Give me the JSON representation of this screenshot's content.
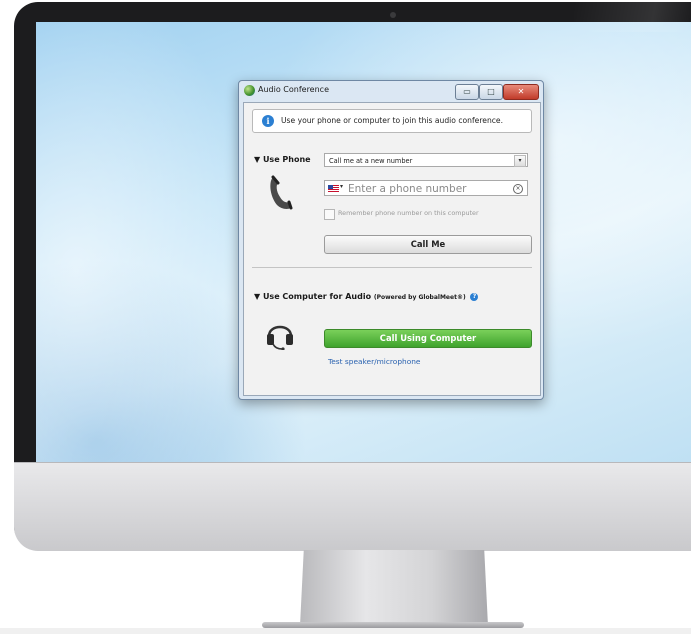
{
  "dialog": {
    "title": "Audio Conference",
    "window_buttons": {
      "minimize": "▭",
      "maximize": "□",
      "close": "✕"
    },
    "info_message": "Use your phone or computer to join this audio conference.",
    "phone_section": {
      "heading": "▼ Use Phone",
      "dial_option": "Call me at a new number",
      "phone_placeholder": "Enter a phone number",
      "remember_label": "Remember phone number on this computer",
      "call_button": "Call Me"
    },
    "computer_section": {
      "heading": "▼ Use Computer for Audio",
      "powered_by": "(Powered by GlobalMeet®)",
      "call_button": "Call Using Computer",
      "test_link": "Test speaker/microphone"
    }
  },
  "icons": [
    "info-icon",
    "phone-handset-icon",
    "headset-icon",
    "help-icon",
    "clear-icon",
    "us-flag-icon",
    "dropdown-arrow-icon"
  ],
  "colors": {
    "accent_green": "#3fa32d",
    "link_blue": "#2b63b0",
    "info_blue": "#2b7fd2",
    "close_red": "#c13b2a"
  }
}
